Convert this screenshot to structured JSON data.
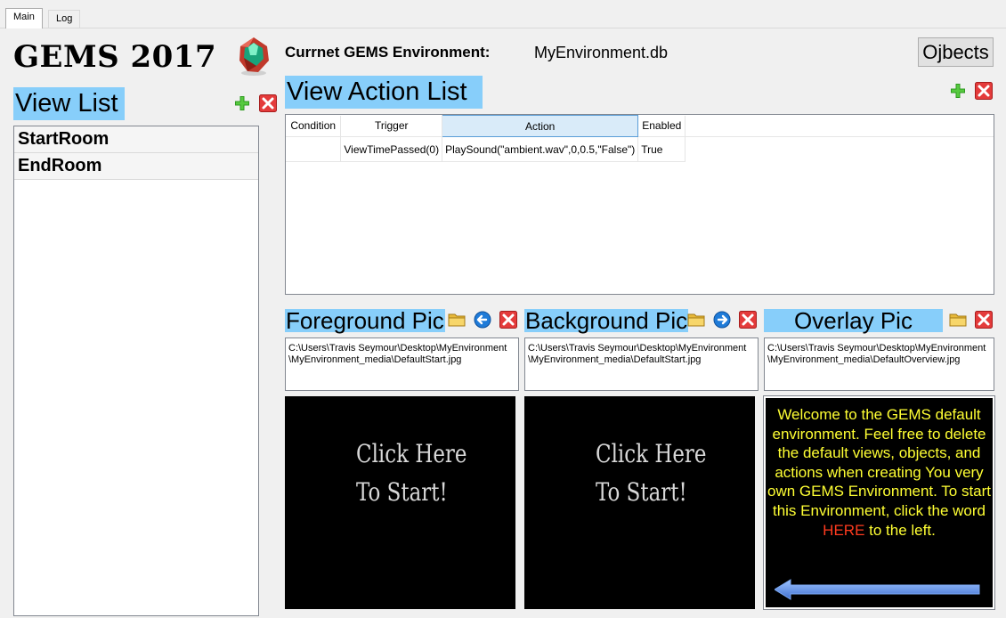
{
  "tabs": [
    {
      "label": "Main"
    },
    {
      "label": "Log"
    }
  ],
  "app_title": "GEMS 2017",
  "view_list": {
    "header": "View List",
    "items": [
      {
        "label": "StartRoom"
      },
      {
        "label": "EndRoom"
      }
    ]
  },
  "environment": {
    "label": "Currnet GEMS Environment:",
    "value": "MyEnvironment.db"
  },
  "objects_button": "Ojbects",
  "action_list": {
    "header": "View Action List",
    "columns": [
      "Condition",
      "Trigger",
      "Action",
      "Enabled"
    ],
    "rows": [
      {
        "condition": "",
        "trigger": "ViewTimePassed(0)",
        "action": "PlaySound(\"ambient.wav\",0,0.5,\"False\")",
        "enabled": "True"
      }
    ]
  },
  "pictures": {
    "foreground": {
      "header": "Foreground Pic",
      "path": "C:\\Users\\Travis Seymour\\Desktop\\MyEnvironment\\MyEnvironment_media\\DefaultStart.jpg",
      "line1": "Click Here",
      "line2": "To Start!"
    },
    "background": {
      "header": "Background Pic",
      "path": "C:\\Users\\Travis Seymour\\Desktop\\MyEnvironment\\MyEnvironment_media\\DefaultStart.jpg",
      "line1": "Click Here",
      "line2": "To Start!"
    },
    "overlay": {
      "header": "Overlay Pic",
      "path": "C:\\Users\\Travis Seymour\\Desktop\\MyEnvironment\\MyEnvironment_media\\DefaultOverview.jpg",
      "text_before": "Welcome to the GEMS default environment. Feel free to delete the default views, objects, and actions when creating You very own GEMS Environment. To start this Environment, click the word",
      "text_here": "HERE",
      "text_after": "to the left."
    }
  },
  "icons": {
    "add": "plus-icon",
    "delete": "x-icon",
    "open": "folder-icon",
    "assign": "arrow-icon",
    "logo": "gem-icon"
  },
  "colors": {
    "header_highlight": "#87cefa",
    "add_green": "#2e9a1f",
    "delete_red": "#d42020",
    "overlay_text": "#ffff33",
    "overlay_here": "#ff3b1f"
  }
}
